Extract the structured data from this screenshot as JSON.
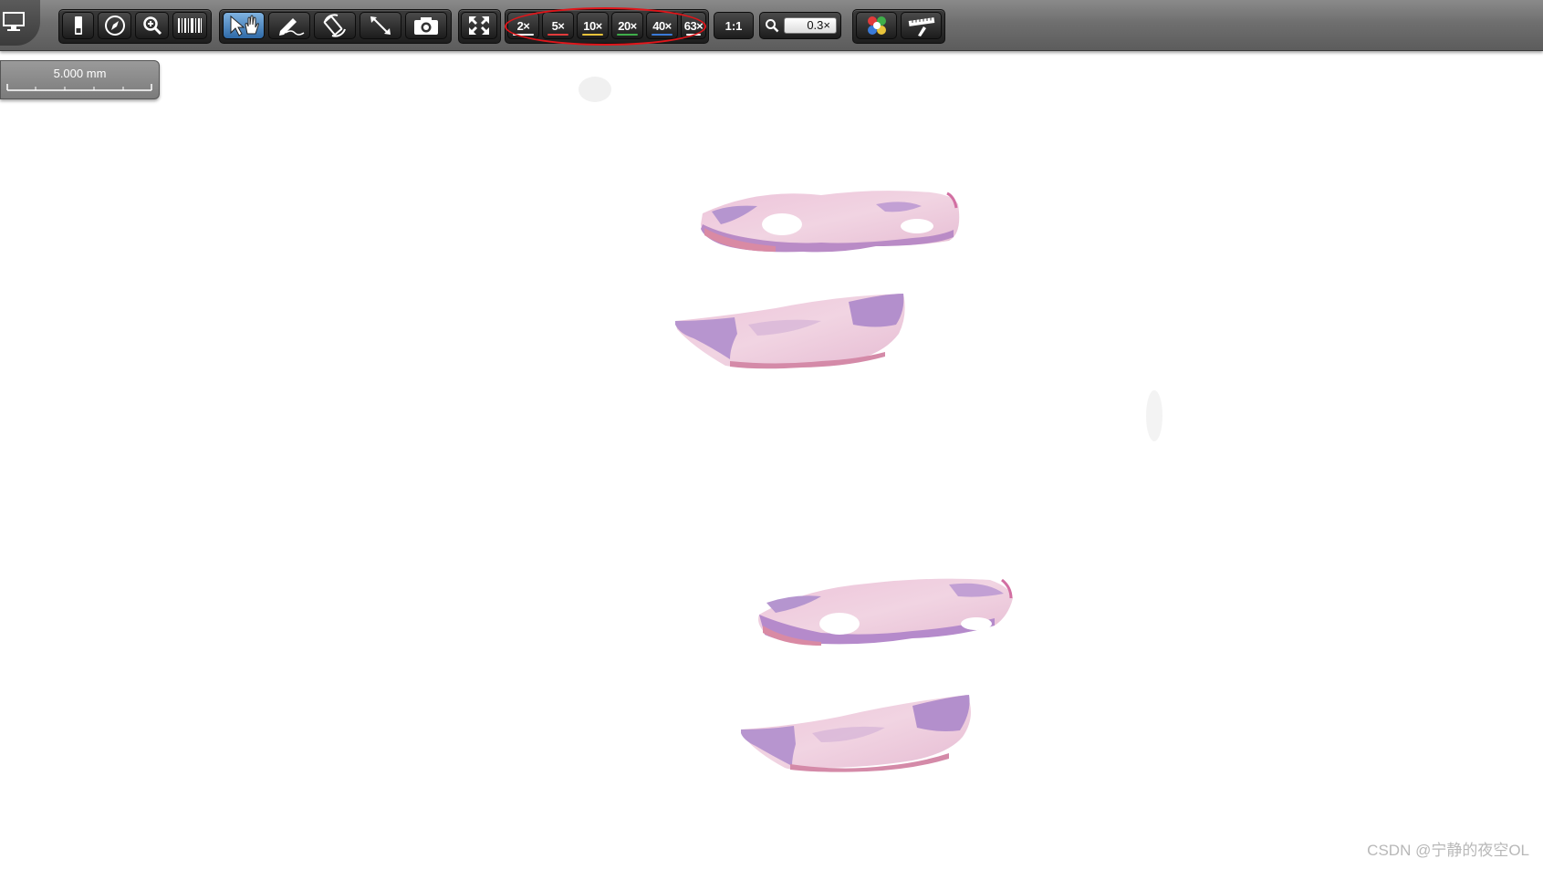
{
  "toolbar": {
    "buttons": [
      {
        "name": "display-mode-button",
        "icon": "monitor-icon"
      },
      {
        "name": "slide-view-button",
        "icon": "slide-icon"
      },
      {
        "name": "navigator-button",
        "icon": "compass-icon"
      },
      {
        "name": "magnifier-button",
        "icon": "magnifier-icon"
      },
      {
        "name": "barcode-button",
        "icon": "barcode-icon"
      },
      {
        "name": "pan-select-button",
        "icon": "pointer-hand-icon",
        "active": true
      },
      {
        "name": "annotate-button",
        "icon": "pen-icon"
      },
      {
        "name": "rotate-button",
        "icon": "rotate-icon"
      },
      {
        "name": "measure-button",
        "icon": "ruler-diagonal-icon"
      },
      {
        "name": "snapshot-button",
        "icon": "camera-icon"
      },
      {
        "name": "fit-to-screen-button",
        "icon": "fullscreen-arrows-icon"
      },
      {
        "name": "color-adjust-button",
        "icon": "color-wheel-icon"
      },
      {
        "name": "calibration-button",
        "icon": "ruler-pen-icon"
      }
    ],
    "magnifications": [
      {
        "label": "2×",
        "color": "#ffffff"
      },
      {
        "label": "5×",
        "color": "#e23b3b"
      },
      {
        "label": "10×",
        "color": "#e8c33a"
      },
      {
        "label": "20×",
        "color": "#3fae4a"
      },
      {
        "label": "40×",
        "color": "#3a7ad8"
      },
      {
        "label": "63×",
        "color": "#ffffff"
      }
    ],
    "one_to_one_label": "1:1",
    "zoom_value": "0.3×"
  },
  "scalebar": {
    "label": "5.000 mm"
  },
  "watermark": "CSDN @宁静的夜空OL",
  "colors": {
    "toolbar": "#6f6f6f",
    "active_button": "#3a78b8",
    "annotation": "#e0151a",
    "tissue_pink": "#edc9d8",
    "tissue_purple": "#a787c4"
  }
}
